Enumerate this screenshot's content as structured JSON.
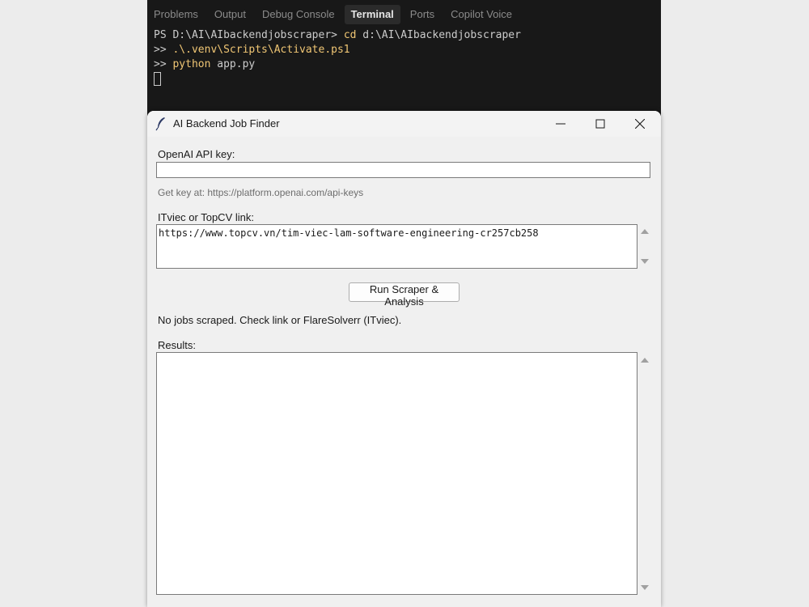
{
  "terminal": {
    "tabs": [
      {
        "label": "Problems",
        "active": false
      },
      {
        "label": "Output",
        "active": false
      },
      {
        "label": "Debug Console",
        "active": false
      },
      {
        "label": "Terminal",
        "active": true
      },
      {
        "label": "Ports",
        "active": false
      },
      {
        "label": "Copilot Voice",
        "active": false
      }
    ],
    "lines": {
      "line1_prompt": "PS D:\\AI\\AIbackendjobscraper> ",
      "line1_cmd": "cd",
      "line1_arg": " d:\\AI\\AIbackendjobscraper",
      "line2_prefix": ">> ",
      "line2_cmd": ".\\.venv\\Scripts\\Activate.ps1",
      "line3_prefix": ">> ",
      "line3_cmd": "python",
      "line3_arg": " app.py"
    },
    "colors": {
      "background": "#181818",
      "command": "#f0c674",
      "text": "#cccccc"
    }
  },
  "window": {
    "title": "AI Backend Job Finder",
    "icon": "feather-icon",
    "controls": {
      "minimize": "minimize-icon",
      "maximize": "maximize-icon",
      "close": "close-icon"
    },
    "api_key": {
      "label": "OpenAI API key:",
      "value": "",
      "hint": "Get key at: https://platform.openai.com/api-keys"
    },
    "link": {
      "label": "ITviec or TopCV link:",
      "value": "https://www.topcv.vn/tim-viec-lam-software-engineering-cr257cb258"
    },
    "run_button": "Run Scraper & Analysis",
    "status": "No jobs scraped. Check link or FlareSolverr (ITviec).",
    "results": {
      "label": "Results:",
      "value": ""
    }
  }
}
